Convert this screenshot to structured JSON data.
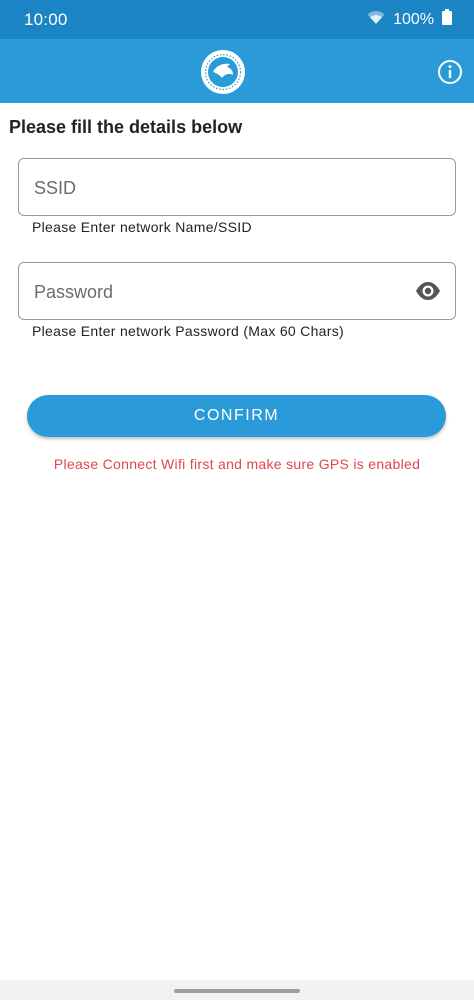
{
  "status_bar": {
    "time": "10:00",
    "battery": "100%",
    "wifi_icon": "wifi-icon",
    "battery_icon": "battery-icon"
  },
  "app_bar": {
    "logo_icon": "bird-logo-icon",
    "info_icon": "info-icon",
    "color": "#2a9bd8"
  },
  "form": {
    "title": "Please fill the details below",
    "ssid": {
      "value": "",
      "placeholder": "SSID",
      "helper": "Please Enter network Name/SSID"
    },
    "password": {
      "value": "",
      "placeholder": "Password",
      "helper": "Please Enter network Password (Max 60 Chars)",
      "toggle_icon": "eye-icon"
    },
    "confirm_label": "CONFIRM",
    "error": "Please Connect Wifi first and make sure GPS is enabled"
  },
  "colors": {
    "status_bar": "#1a84c4",
    "accent": "#2a9bd8",
    "error": "#e0474c"
  }
}
